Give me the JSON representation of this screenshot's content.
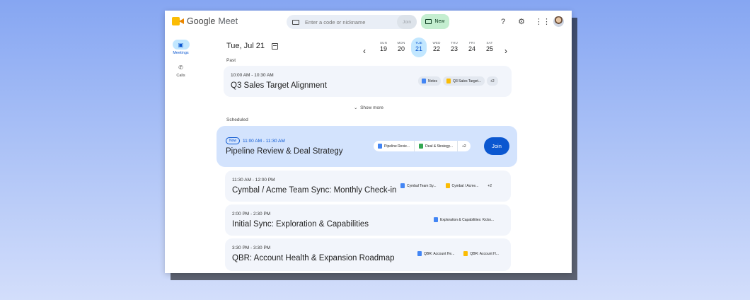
{
  "app": {
    "brand_google": "Google",
    "brand_meet": "Meet"
  },
  "search": {
    "placeholder": "Enter a code or nickname",
    "join_label": "Join"
  },
  "new_button": {
    "label": "New"
  },
  "rail": {
    "items": [
      {
        "label": "Meetings"
      },
      {
        "label": "Calls"
      }
    ]
  },
  "date_header": "Tue, Jul 21",
  "days": [
    {
      "name": "SUN",
      "num": "19"
    },
    {
      "name": "MON",
      "num": "20"
    },
    {
      "name": "TUE",
      "num": "21"
    },
    {
      "name": "WED",
      "num": "22"
    },
    {
      "name": "THU",
      "num": "23"
    },
    {
      "name": "FRI",
      "num": "24"
    },
    {
      "name": "SAT",
      "num": "25"
    }
  ],
  "past": {
    "label": "Past",
    "meeting": {
      "time": "10:00 AM - 10:30 AM",
      "title": "Q3 Sales Target Alignment",
      "chips": [
        "Notes",
        "Q3 Sales Target...",
        "+2"
      ]
    }
  },
  "show_more": "Show more",
  "scheduled": {
    "label": "Scheduled",
    "now_badge": "Now",
    "now_meeting": {
      "time": "11:00 AM - 11:30 AM",
      "title": "Pipeline Review & Deal Strategy",
      "chips": [
        "Pipeline Revie...",
        "Deal & Strategy...",
        "+2"
      ],
      "join_label": "Join"
    },
    "meetings": [
      {
        "time": "11:30 AM - 12:00 PM",
        "title": "Cymbal / Acme Team Sync: Monthly Check-in",
        "chips": [
          "Cymbal Team Sy...",
          "Cymbal / Acme...",
          "+2"
        ]
      },
      {
        "time": "2:00 PM - 2:30 PM",
        "title": "Initial Sync: Exploration & Capabilities",
        "chips": [
          "Exploration & Capabilities: Kicko..."
        ]
      },
      {
        "time": "3:30 PM - 3:30 PM",
        "title": "QBR: Account Health & Expansion Roadmap",
        "chips": [
          "QBR: Account He...",
          "QBR: Account H..."
        ]
      }
    ]
  }
}
